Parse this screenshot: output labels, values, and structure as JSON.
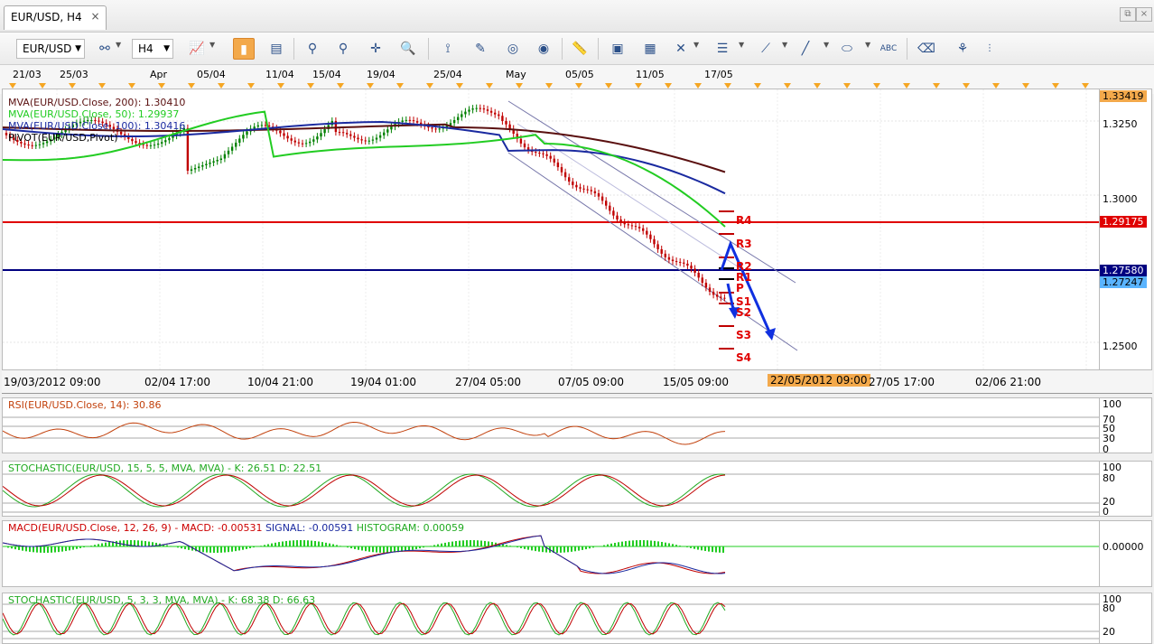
{
  "tab": {
    "title": "EUR/USD, H4",
    "close": "×"
  },
  "window": {
    "restore": "⧉",
    "close": "×"
  },
  "toolbar": {
    "symbol": "EUR/USD",
    "timeframe": "H4"
  },
  "date_labels": [
    [
      "21/03",
      14
    ],
    [
      "25/03",
      66
    ],
    [
      "Apr",
      166
    ],
    [
      "05/04",
      218
    ],
    [
      "11/04",
      294
    ],
    [
      "15/04",
      346
    ],
    [
      "19/04",
      406
    ],
    [
      "25/04",
      480
    ],
    [
      "May",
      560
    ],
    [
      "05/05",
      626
    ],
    [
      "11/05",
      704
    ],
    [
      "17/05",
      780
    ]
  ],
  "legend": [
    "MVA(EUR/USD.Close, 200): 1.30410",
    "MVA(EUR/USD.Close, 50): 1.29937",
    "MVA(EUR/USD.Close, 100): 1.30416",
    "PIVOT(EUR/USD,Pivot)"
  ],
  "legend_colors": [
    "#5a1010",
    "#22cc22",
    "#1a2aa0",
    "#000000"
  ],
  "price_scale": [
    "1.3250",
    "1.3000",
    "1.2500"
  ],
  "price_tags": {
    "top": "1.33419",
    "resistance": "1.29175",
    "pivot_line": "1.27580",
    "current": "1.27247"
  },
  "pivot_labels": [
    "R4",
    "R3",
    "R2",
    "R1",
    "P",
    "S1",
    "S2",
    "S3",
    "S4"
  ],
  "time_labels": [
    "19/03/2012 09:00",
    "02/04 17:00",
    "10/04 21:00",
    "19/04 01:00",
    "27/04 05:00",
    "07/05 09:00",
    "15/05 09:00",
    "22/05/2012 09:00",
    "27/05 17:00",
    "02/06 21:00"
  ],
  "rsi": {
    "title": "RSI(EUR/USD.Close, 14): 30.86",
    "scale": [
      "100",
      "70",
      "50",
      "30",
      "0"
    ]
  },
  "stoch1": {
    "title": "STOCHASTIC(EUR/USD, 15, 5, 5, MVA, MVA) -  K: 26.51  D: 22.51",
    "scale": [
      "100",
      "80",
      "20",
      "0"
    ]
  },
  "macd": {
    "label": "MACD(EUR/USD.Close, 12, 26, 9) -",
    "macd": "MACD: -0.00531",
    "signal": "SIGNAL: -0.00591",
    "hist": "HISTOGRAM: 0.00059",
    "scale": "0.00000"
  },
  "stoch2": {
    "title": "STOCHASTIC(EUR/USD, 5, 3, 3, MVA, MVA) -  K: 68.38  D: 66.63",
    "scale": [
      "100",
      "80",
      "20"
    ]
  },
  "colors": {
    "accent": "#f3a94b",
    "resistance": "#e00000",
    "pivot": "#000080",
    "current": "#5ab4ff",
    "arrow": "#1030e0"
  }
}
